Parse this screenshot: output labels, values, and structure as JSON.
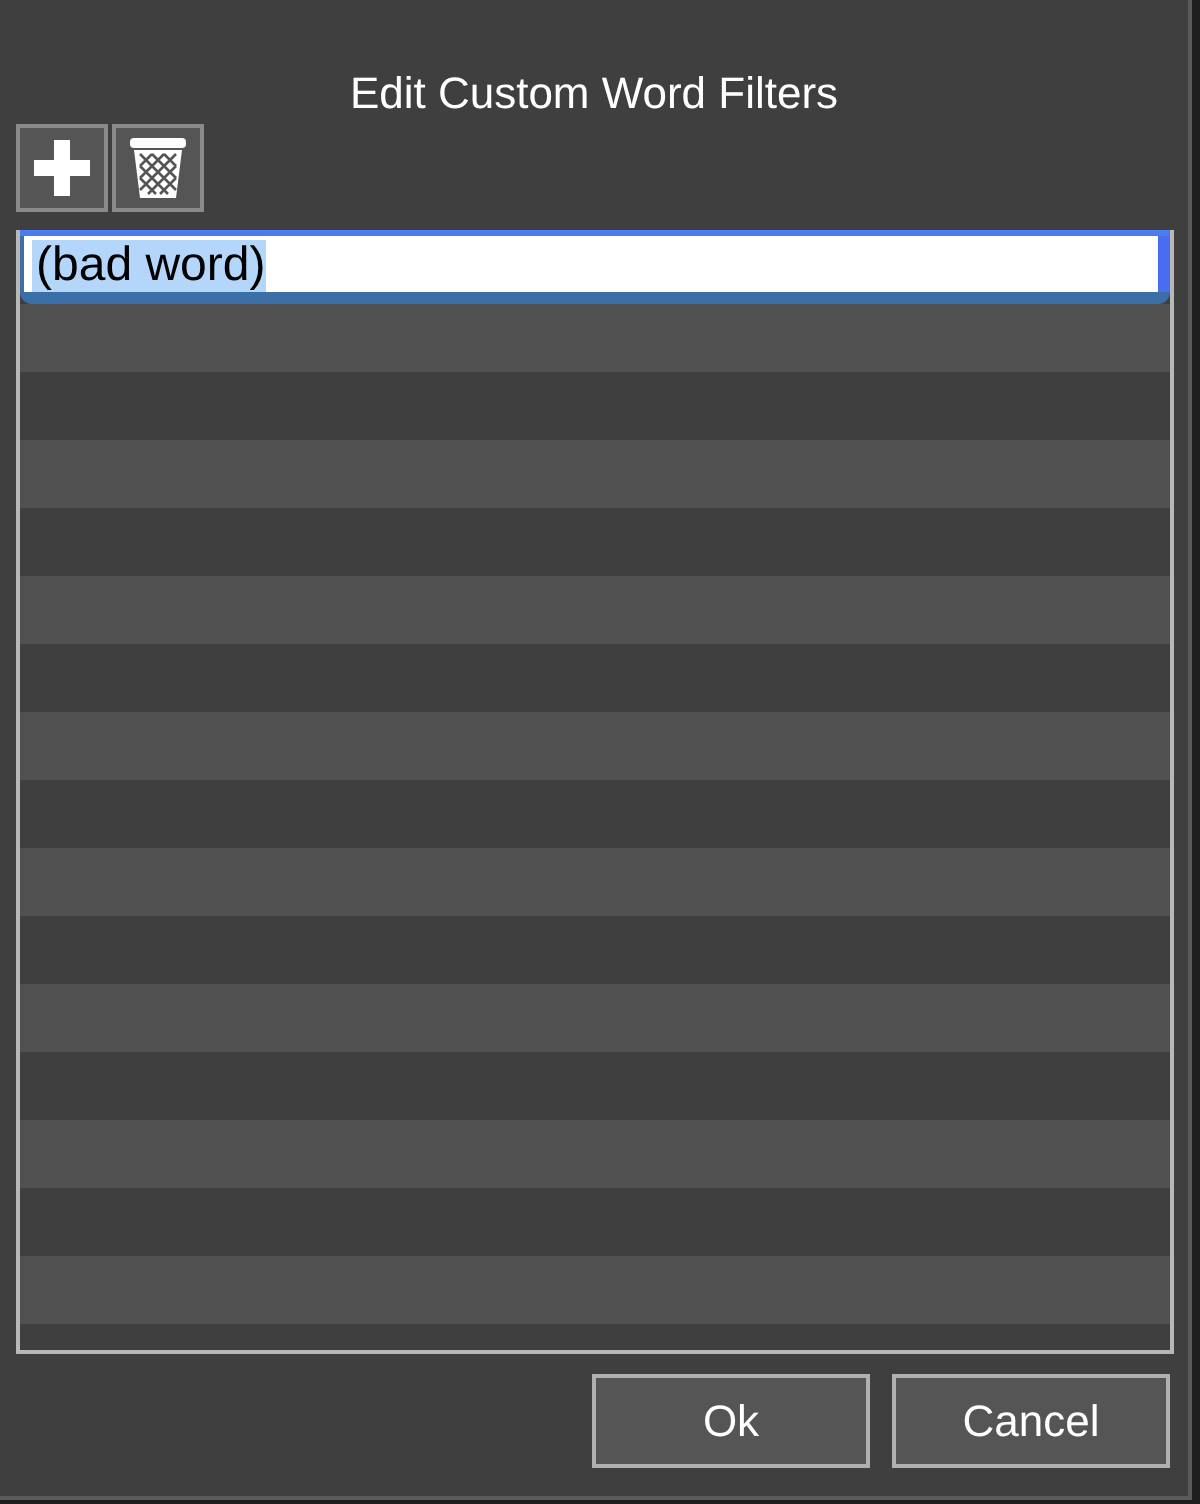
{
  "dialog": {
    "title": "Edit Custom Word Filters"
  },
  "toolbar": [
    {
      "kind": "add"
    },
    {
      "kind": "delete"
    }
  ],
  "filters": [
    {
      "value": "(bad word)",
      "editing": true
    }
  ],
  "buttons": [
    "Ok",
    "Cancel"
  ]
}
